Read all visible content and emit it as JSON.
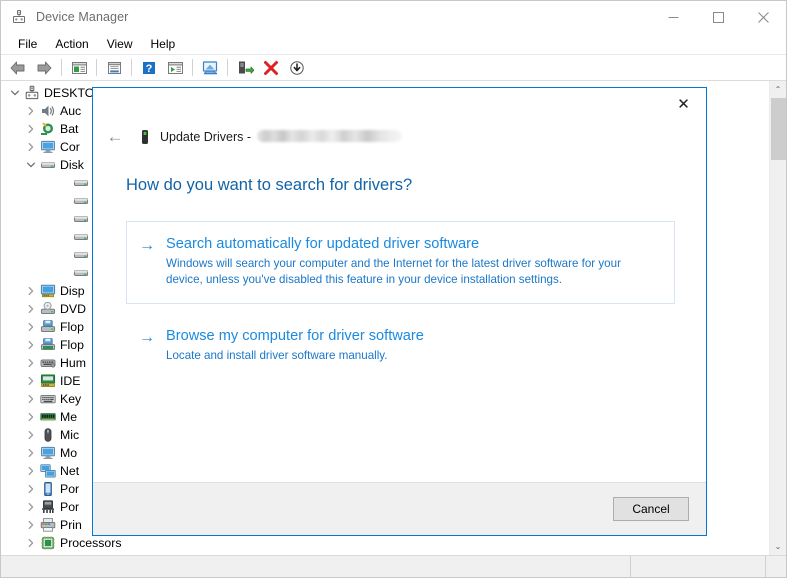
{
  "window": {
    "title": "Device Manager",
    "icon": "device-manager-icon",
    "controls": {
      "minimize": "—",
      "maximize": "☐",
      "close": "✕"
    }
  },
  "menu": {
    "items": [
      {
        "label": "File",
        "name": "menu-file"
      },
      {
        "label": "Action",
        "name": "menu-action"
      },
      {
        "label": "View",
        "name": "menu-view"
      },
      {
        "label": "Help",
        "name": "menu-help"
      }
    ]
  },
  "toolbar": {
    "buttons": [
      {
        "name": "back-icon",
        "tip": "Back"
      },
      {
        "name": "forward-icon",
        "tip": "Forward"
      },
      {
        "name": "show-hide-console-tree-icon",
        "tip": "Show/Hide Console Tree"
      },
      {
        "name": "properties-icon",
        "tip": "Properties"
      },
      {
        "name": "help-icon",
        "tip": "Help"
      },
      {
        "name": "scan-for-hardware-changes-icon",
        "tip": "Scan for hardware changes"
      },
      {
        "name": "update-driver-icon",
        "tip": "Update driver"
      },
      {
        "name": "enable-device-icon",
        "tip": "Enable device"
      },
      {
        "name": "uninstall-device-icon",
        "tip": "Uninstall device"
      },
      {
        "name": "disable-device-icon",
        "tip": "Disable device"
      }
    ]
  },
  "tree": {
    "nodes": [
      {
        "label": "DESKTO",
        "icon": "computer-icon",
        "depth": 0,
        "expanded": true,
        "chevron": "⌄"
      },
      {
        "label": "Auc",
        "icon": "speaker-icon",
        "depth": 1,
        "expanded": false,
        "chevron": "›"
      },
      {
        "label": "Bat",
        "icon": "battery-icon",
        "depth": 1,
        "expanded": false,
        "chevron": "›"
      },
      {
        "label": "Cor",
        "icon": "monitor-icon",
        "depth": 1,
        "expanded": false,
        "chevron": "›"
      },
      {
        "label": "Disk",
        "icon": "disk-drive-icon",
        "depth": 1,
        "expanded": true,
        "chevron": "⌄"
      },
      {
        "label": "",
        "icon": "disk-drive-icon",
        "depth": 2,
        "expanded": false,
        "chevron": ""
      },
      {
        "label": "",
        "icon": "disk-drive-icon",
        "depth": 2,
        "expanded": false,
        "chevron": ""
      },
      {
        "label": "",
        "icon": "disk-drive-icon",
        "depth": 2,
        "expanded": false,
        "chevron": ""
      },
      {
        "label": "",
        "icon": "disk-drive-icon",
        "depth": 2,
        "expanded": false,
        "chevron": ""
      },
      {
        "label": "",
        "icon": "disk-drive-icon",
        "depth": 2,
        "expanded": false,
        "chevron": ""
      },
      {
        "label": "",
        "icon": "disk-drive-icon",
        "depth": 2,
        "expanded": false,
        "chevron": ""
      },
      {
        "label": "Disp",
        "icon": "display-adapter-icon",
        "depth": 1,
        "expanded": false,
        "chevron": "›"
      },
      {
        "label": "DVD",
        "icon": "dvd-drive-icon",
        "depth": 1,
        "expanded": false,
        "chevron": "›"
      },
      {
        "label": "Flop",
        "icon": "floppy-drive-icon",
        "depth": 1,
        "expanded": false,
        "chevron": "›"
      },
      {
        "label": "Flop",
        "icon": "floppy-controller-icon",
        "depth": 1,
        "expanded": false,
        "chevron": "›"
      },
      {
        "label": "Hum",
        "icon": "hid-icon",
        "depth": 1,
        "expanded": false,
        "chevron": "›"
      },
      {
        "label": "IDE",
        "icon": "ide-controller-icon",
        "depth": 1,
        "expanded": false,
        "chevron": "›"
      },
      {
        "label": "Key",
        "icon": "keyboard-icon",
        "depth": 1,
        "expanded": false,
        "chevron": "›"
      },
      {
        "label": "Me",
        "icon": "memory-icon",
        "depth": 1,
        "expanded": false,
        "chevron": "›"
      },
      {
        "label": "Mic",
        "icon": "mouse-icon",
        "depth": 1,
        "expanded": false,
        "chevron": "›"
      },
      {
        "label": "Mo",
        "icon": "monitor-icon",
        "depth": 1,
        "expanded": false,
        "chevron": "›"
      },
      {
        "label": "Net",
        "icon": "network-adapter-icon",
        "depth": 1,
        "expanded": false,
        "chevron": "›"
      },
      {
        "label": "Por",
        "icon": "portable-device-icon",
        "depth": 1,
        "expanded": false,
        "chevron": "›"
      },
      {
        "label": "Por",
        "icon": "ports-icon",
        "depth": 1,
        "expanded": false,
        "chevron": "›"
      },
      {
        "label": "Prin",
        "icon": "printer-icon",
        "depth": 1,
        "expanded": false,
        "chevron": "›"
      },
      {
        "label": "Processors",
        "icon": "processor-icon",
        "depth": 1,
        "expanded": false,
        "chevron": "›"
      }
    ]
  },
  "scrollbar": {
    "up_arrow": "⌃",
    "down_arrow": "⌄"
  },
  "status_bar": {
    "segment_main": "",
    "segment_2": "",
    "segment_3": ""
  },
  "dialog": {
    "title_prefix": "Update Drivers - ",
    "device_name_redacted": true,
    "icon": "portable-device-icon",
    "back_arrow": "←",
    "close": "✕",
    "question": "How do you want to search for drivers?",
    "options": [
      {
        "name": "search-automatically-option",
        "arrow": "→",
        "title": "Search automatically for updated driver software",
        "description": "Windows will search your computer and the Internet for the latest driver software for your device, unless you've disabled this feature in your device installation settings.",
        "boxed": true
      },
      {
        "name": "browse-my-computer-option",
        "arrow": "→",
        "title": "Browse my computer for driver software",
        "description": "Locate and install driver software manually.",
        "boxed": false
      }
    ],
    "cancel_label": "Cancel"
  },
  "colors": {
    "accent_blue": "#0078d7",
    "link_blue": "#1b8ae0",
    "link_desc_blue": "#1b77c9",
    "heading_blue": "#1263a8",
    "box_border": "#d8e4ee",
    "footer_bg": "#f0f0f0",
    "button_bg": "#e1e1e1",
    "button_border": "#adadad"
  }
}
